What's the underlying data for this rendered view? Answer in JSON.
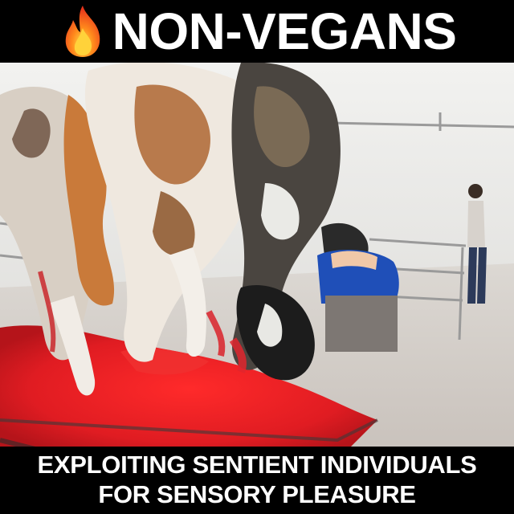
{
  "header": {
    "icon": "fire-emoji",
    "title": "NON-VEGANS"
  },
  "caption": {
    "line1": "EXPLOITING SENTIENT INDIVIDUALS",
    "line2": "FOR SENSORY PLEASURE"
  },
  "colors": {
    "background": "#000000",
    "text": "#ffffff",
    "blood": "#e0202a",
    "floor": "#e9e6e2"
  }
}
